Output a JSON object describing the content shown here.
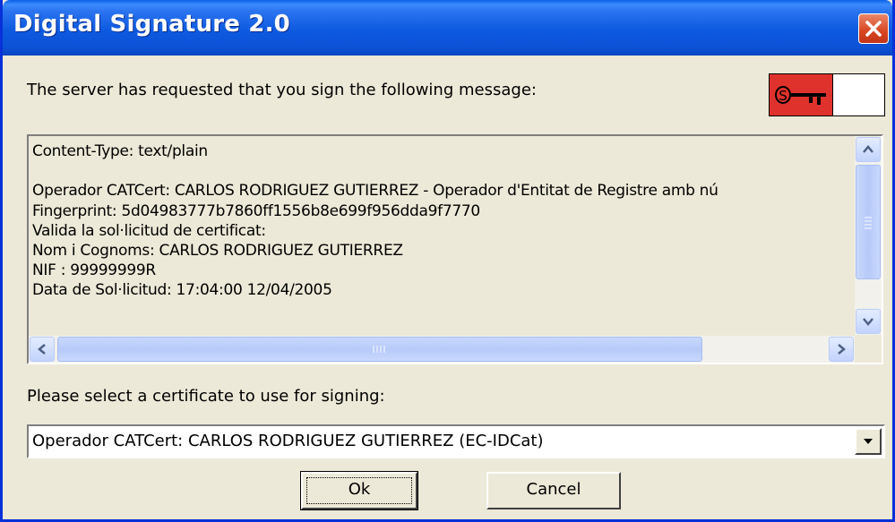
{
  "window": {
    "title": "Digital Signature 2.0"
  },
  "prompt": "The server has requested that you sign the following message:",
  "message_lines": [
    "Content-Type: text/plain",
    "",
    "Operador CATCert: CARLOS RODRIGUEZ GUTIERREZ - Operador d'Entitat de Registre amb nú",
    "Fingerprint: 5d04983777b7860ff1556b8e699f956dda9f7770",
    "Valida la sol·licitud de certificat:",
    "Nom i Cognoms: CARLOS RODRIGUEZ GUTIERREZ",
    "NIF : 99999999R",
    "Data de Sol·licitud: 17:04:00 12/04/2005"
  ],
  "certificate": {
    "label": "Please select a certificate to use for signing:",
    "selected": "Operador CATCert: CARLOS RODRIGUEZ GUTIERREZ (EC-IDCat)"
  },
  "buttons": {
    "ok": "Ok",
    "cancel": "Cancel"
  },
  "icons": {
    "key": "key-icon",
    "close": "close-icon"
  },
  "colors": {
    "titlebar": "#0A5FE8",
    "key_bg": "#E0322C",
    "dialog_bg": "#ECE9D8"
  }
}
